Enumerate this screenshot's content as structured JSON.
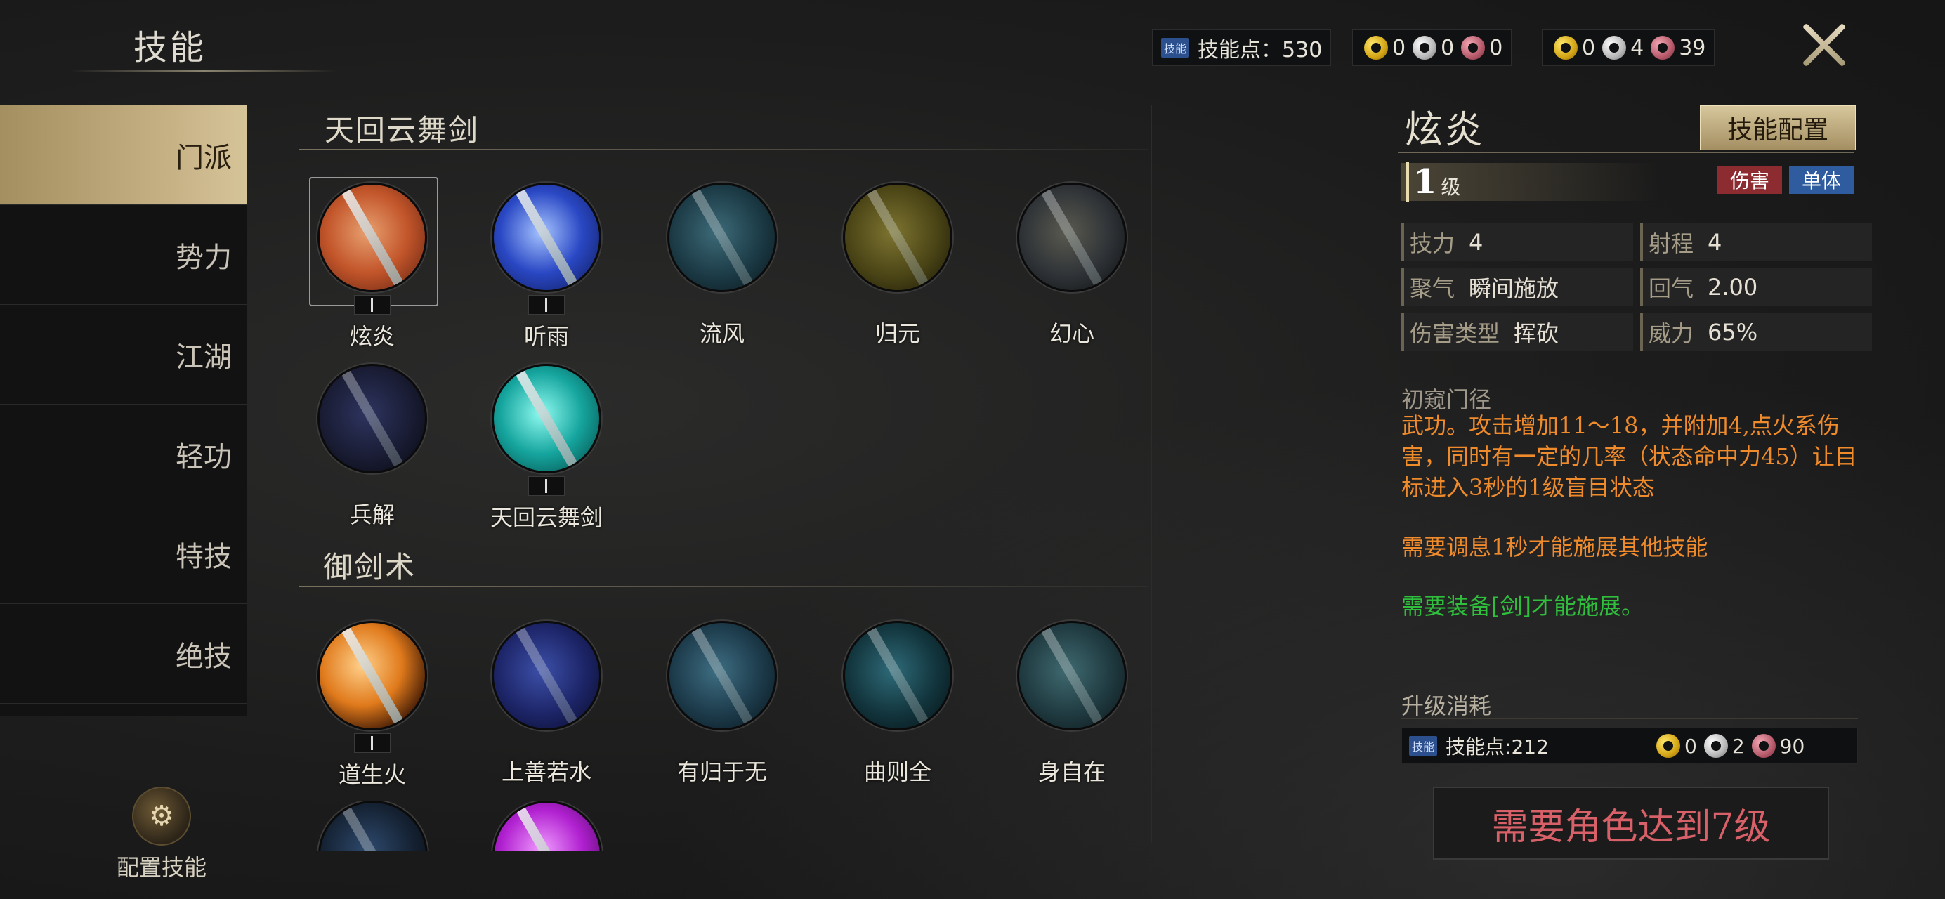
{
  "header": {
    "title": "技能",
    "skill_points_badge": "技能",
    "skill_points_label": "技能点：530",
    "currency_a": {
      "gold": "0",
      "silver": "0",
      "copper": "0"
    },
    "currency_b": {
      "gold": "0",
      "silver": "4",
      "copper": "39"
    }
  },
  "sidebar": {
    "items": [
      {
        "label": "门派",
        "active": true
      },
      {
        "label": "势力"
      },
      {
        "label": "江湖"
      },
      {
        "label": "轻功"
      },
      {
        "label": "特技"
      },
      {
        "label": "绝技"
      }
    ],
    "config_label": "配置技能"
  },
  "sections": [
    {
      "title": "天回云舞剑",
      "skills": [
        {
          "name": "炫炎",
          "color": "#c2552a"
        },
        {
          "name": "听雨",
          "color": "#2a48c4"
        },
        {
          "name": "流风",
          "color": "#1b3a45"
        },
        {
          "name": "归元",
          "color": "#4a4416"
        },
        {
          "name": "幻心",
          "color": "#2e3236"
        },
        {
          "name": "兵解",
          "color": "#191c33"
        },
        {
          "name": "天回云舞剑",
          "color": "#15a59e"
        }
      ]
    },
    {
      "title": "御剑术",
      "skills": [
        {
          "name": "道生火",
          "color": "#e07a1c"
        },
        {
          "name": "上善若水",
          "color": "#1c2466"
        },
        {
          "name": "有归于无",
          "color": "#1c3a4a"
        },
        {
          "name": "曲则全",
          "color": "#12343c"
        },
        {
          "name": "身自在",
          "color": "#1f3a40"
        }
      ]
    }
  ],
  "detail": {
    "name": "炫炎",
    "config_button": "技能配置",
    "level_num": "1",
    "level_unit": "级",
    "tag_damage": "伤害",
    "tag_single": "单体",
    "attrs": {
      "power_k": "技力",
      "power_v": "4",
      "range_k": "射程",
      "range_v": "4",
      "charge_k": "聚气",
      "charge_v": "瞬间施放",
      "regen_k": "回气",
      "regen_v": "2.00",
      "dmgtype_k": "伤害类型",
      "dmgtype_v": "挥砍",
      "might_k": "威力",
      "might_v": "65%"
    },
    "desc_head": "初窥门径",
    "desc": "武功。攻击增加11～18，并附加4,点火系伤害，同时有一定的几率（状态命中力45）让目标进入3秒的1级盲目状态",
    "desc_cooldown": "需要调息1秒才能施展其他技能",
    "desc_require": "需要装备[剑]才能施展。",
    "upgrade_title": "升级消耗",
    "upgrade_badge": "技能",
    "upgrade_points": "技能点:212",
    "upgrade_gold": "0",
    "upgrade_silver": "2",
    "upgrade_copper": "90",
    "requirement_button": "需要角色达到7级"
  }
}
